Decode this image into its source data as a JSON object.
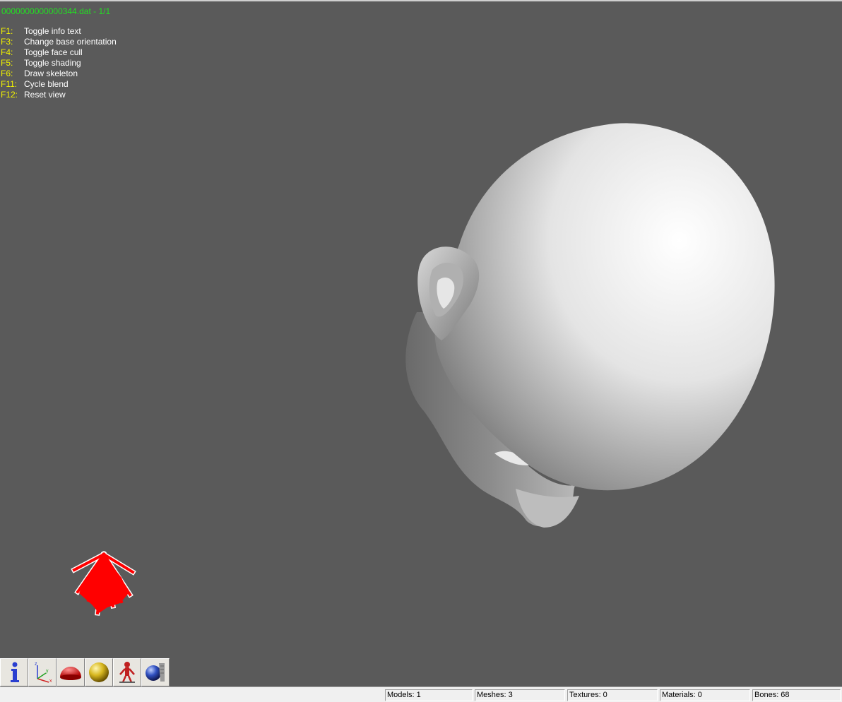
{
  "viewport": {
    "file_title": "0000000000000344.dat - 1/1",
    "help": [
      {
        "key": "F1:",
        "label": "Toggle info text"
      },
      {
        "key": "F3:",
        "label": "Change base orientation"
      },
      {
        "key": "F4:",
        "label": "Toggle face cull"
      },
      {
        "key": "F5:",
        "label": "Toggle shading"
      },
      {
        "key": "F6:",
        "label": "Draw skeleton"
      },
      {
        "key": "F11:",
        "label": "Cycle blend"
      },
      {
        "key": "F12:",
        "label": "Reset view"
      }
    ],
    "background_color": "#5a5a5a",
    "title_color": "#22e022",
    "key_color": "#f2f200",
    "skeleton_color": "#ff0000"
  },
  "toolbar": {
    "buttons": [
      {
        "name": "info-icon"
      },
      {
        "name": "axes-icon",
        "axis_labels": [
          "z",
          "y",
          "x"
        ]
      },
      {
        "name": "dome-icon"
      },
      {
        "name": "sphere-icon"
      },
      {
        "name": "skeleton-figure-icon"
      },
      {
        "name": "globe-tool-icon"
      }
    ]
  },
  "status": {
    "models": "Models: 1",
    "meshes": "Meshes: 3",
    "textures": "Textures: 0",
    "materials": "Materials: 0",
    "bones": "Bones: 68"
  }
}
